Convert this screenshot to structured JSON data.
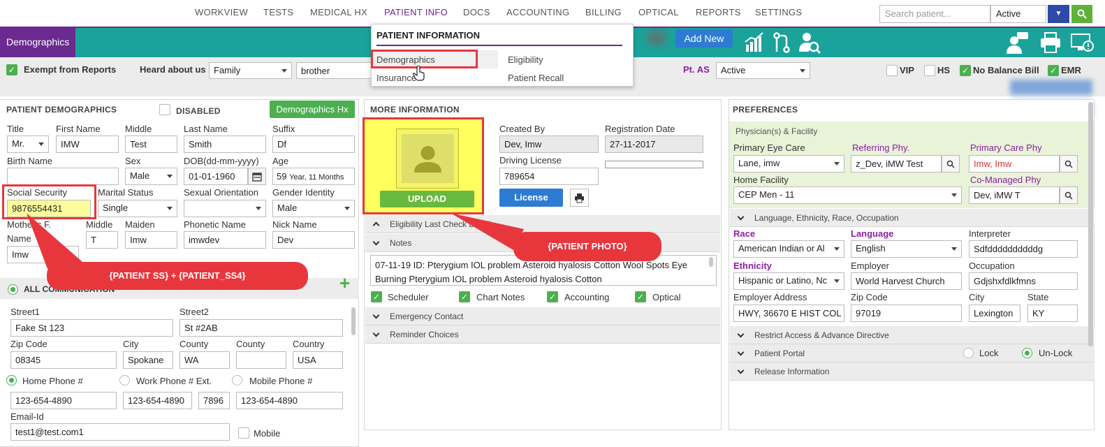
{
  "nav": {
    "items": [
      "WORKVIEW",
      "TESTS",
      "MEDICAL HX",
      "PATIENT INFO",
      "DOCS",
      "ACCOUNTING",
      "BILLING",
      "OPTICAL",
      "REPORTS",
      "SETTINGS"
    ],
    "active": "PATIENT INFO",
    "search_placeholder": "Search patient...",
    "status_value": "Active"
  },
  "menu": {
    "title": "PATIENT INFORMATION",
    "items": [
      "Demographics",
      "Eligibility",
      "Insurance",
      "Patient Recall"
    ]
  },
  "toolbar": {
    "demographics_tab": "Demographics",
    "add_new": "Add New"
  },
  "options": {
    "exempt": "Exempt from Reports",
    "heard_label": "Heard about us",
    "heard_value": "Family",
    "heard_detail": "brother",
    "pt_as_label": "Pt. AS",
    "pt_as_value": "Active",
    "vip": "VIP",
    "hs": "HS",
    "no_balance": "No Balance Bill",
    "emr": "EMR"
  },
  "demographics": {
    "title": "PATIENT DEMOGRAPHICS",
    "disabled": "DISABLED",
    "hx_button": "Demographics Hx",
    "title_label": "Title",
    "title_value": "Mr.",
    "first_label": "First Name",
    "first_value": "IMW",
    "middle_label": "Middle",
    "middle_value": "Test",
    "last_label": "Last Name",
    "last_value": "Smith",
    "suffix_label": "Suffix",
    "suffix_value": "Df",
    "birth_label": "Birth Name",
    "sex_label": "Sex",
    "sex_value": "Male",
    "dob_label": "DOB(dd-mm-yyyy)",
    "dob_value": "01-01-1960",
    "age_label": "Age",
    "age_value": "59",
    "age_unit": "Year, 11 Months",
    "ss_label": "Social Security",
    "ss_value": "9876554431",
    "marital_label": "Marital Status",
    "marital_value": "Single",
    "orientation_label": "Sexual Orientation",
    "gender_label": "Gender Identity",
    "gender_value": "Male",
    "mother_label_1": "Mother's F.",
    "mother_label_2": "Name",
    "mother_value": "Imw",
    "mmiddle_label": "Middle",
    "mmiddle_value": "T",
    "maiden_label": "Maiden",
    "maiden_value": "Imw",
    "phonetic_label": "Phonetic Name",
    "phonetic_value": "imwdev",
    "nick_label": "Nick Name",
    "nick_value": "Dev",
    "all_comm": "ALL COMMUNICATION",
    "street1_label": "Street1",
    "street1_value": "Fake St 123",
    "street2_label": "Street2",
    "street2_value": "St #2AB",
    "zip_label": "Zip Code",
    "zip_value": "08345",
    "city_label": "City",
    "city_value": "Spokane",
    "county_label": "County",
    "county_value": "WA",
    "county2_label": "County",
    "country_label": "Country",
    "country_value": "USA",
    "home_phone_label": "Home Phone #",
    "home_phone_value": "123-654-4890",
    "work_phone_label": "Work Phone # Ext.",
    "work_phone_value": "123-654-4890",
    "ext_value": "7896",
    "mobile_phone_label": "Mobile Phone #",
    "mobile_phone_value": "123-654-4890",
    "email_label": "Email-Id",
    "email_value": "test1@test.com1",
    "mobile_chk": "Mobile"
  },
  "more_info": {
    "title": "MORE INFORMATION",
    "upload": "UPLOAD",
    "created_by_label": "Created By",
    "created_by_value": "Dev, Imw",
    "reg_date_label": "Registration Date",
    "reg_date_value": "27-11-2017",
    "license_label": "Driving License",
    "license_value": "789654",
    "license_btn": "License",
    "acc_eligibility": "Eligibility Last Check Detail",
    "acc_notes": "Notes",
    "notes_text": "07-11-19 ID: Pterygium IOL problem Asteroid hyalosis Cotton Wool Spots Eye Burning Pterygium IOL problem Asteroid hyalosis Cotton",
    "chk_scheduler": "Scheduler",
    "chk_chart": "Chart Notes",
    "chk_accounting": "Accounting",
    "chk_optical": "Optical",
    "acc_emergency": "Emergency Contact",
    "acc_reminder": "Reminder Choices"
  },
  "preferences": {
    "title": "PREFERENCES",
    "physician_header": "Physician(s) & Facility",
    "primary_eye_label": "Primary Eye Care",
    "primary_eye_value": "Lane, imw",
    "referring_label": "Referring Phy.",
    "referring_value": "z_Dev, iMW Test",
    "primary_care_label": "Primary Care Phy",
    "primary_care_value": "Imw, Imw",
    "home_facility_label": "Home Facility",
    "home_facility_value": "CEP Men - 11",
    "comanaged_label": "Co-Managed Phy",
    "comanaged_value": "Dev, iMW T",
    "lang_header": "Language, Ethnicity, Race, Occupation",
    "race_label": "Race",
    "race_value": "American Indian or Al",
    "language_label": "Language",
    "language_value": "English",
    "interpreter_label": "Interpreter",
    "interpreter_value": "Sdfddddddddddg",
    "ethnicity_label": "Ethnicity",
    "ethnicity_value": "Hispanic or Latino, Nc",
    "employer_label": "Employer",
    "employer_value": "World Harvest Church",
    "occupation_label": "Occupation",
    "occupation_value": "Gdjshxfdlkfmns",
    "emp_address_label": "Employer Address",
    "emp_address_value": "HWY, 36670 E HIST COL",
    "pzip_label": "Zip Code",
    "pzip_value": "97019",
    "pcity_label": "City",
    "pcity_value": "Lexington",
    "state_label": "State",
    "state_value": "KY",
    "restrict": "Restrict Access & Advance Directive",
    "portal": "Patient Portal",
    "lock": "Lock",
    "unlock": "Un-Lock",
    "release": "Release Information"
  },
  "callouts": {
    "ss": "{PATIENT SS} + {PATIENT_SS4}",
    "photo": "{PATIENT PHOTO}"
  },
  "colors": {
    "accent_purple": "#6a2a8f",
    "teal": "#1aa39a",
    "green": "#4caf50",
    "callout_red": "#e8363d"
  }
}
